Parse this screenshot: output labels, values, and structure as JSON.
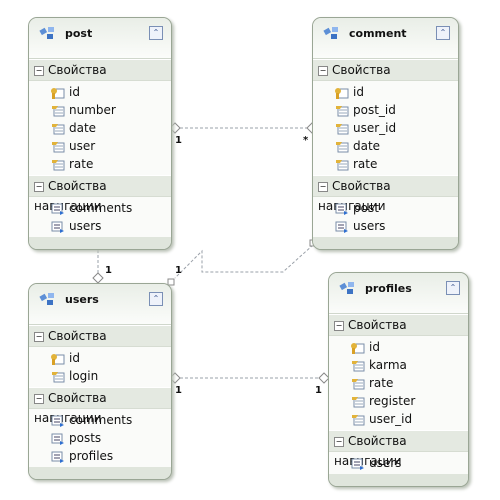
{
  "entities": [
    {
      "id": "post",
      "title": "post",
      "props_label": "Свойства",
      "props": [
        "id",
        "number",
        "date",
        "user",
        "rate"
      ],
      "nav_label": "Свойства навигации",
      "nav": [
        "comments",
        "users"
      ]
    },
    {
      "id": "comment",
      "title": "comment",
      "props_label": "Свойства",
      "props": [
        "id",
        "post_id",
        "user_id",
        "date",
        "rate"
      ],
      "nav_label": "Свойства навигации",
      "nav": [
        "post",
        "users"
      ]
    },
    {
      "id": "users",
      "title": "users",
      "props_label": "Свойства",
      "props": [
        "id",
        "login"
      ],
      "nav_label": "Свойства навигации",
      "nav": [
        "comments",
        "posts",
        "profiles"
      ]
    },
    {
      "id": "profiles",
      "title": "profiles",
      "props_label": "Свойства",
      "props": [
        "id",
        "karma",
        "rate",
        "register",
        "user_id"
      ],
      "nav_label": "Свойства навигации",
      "nav": [
        "users"
      ]
    }
  ],
  "associations": [
    {
      "from": "post",
      "to": "comment",
      "from_mult": "1",
      "to_mult": "*"
    },
    {
      "from": "post",
      "to": "users",
      "from_mult": "*",
      "to_mult": "1"
    },
    {
      "from": "comment",
      "to": "users",
      "from_mult": "*",
      "to_mult": "1"
    },
    {
      "from": "users",
      "to": "profiles",
      "from_mult": "1",
      "to_mult": "1"
    }
  ],
  "colors": {
    "border": "#9aa695",
    "header": "#e4e9e1",
    "connector": "#9aa0a8"
  }
}
